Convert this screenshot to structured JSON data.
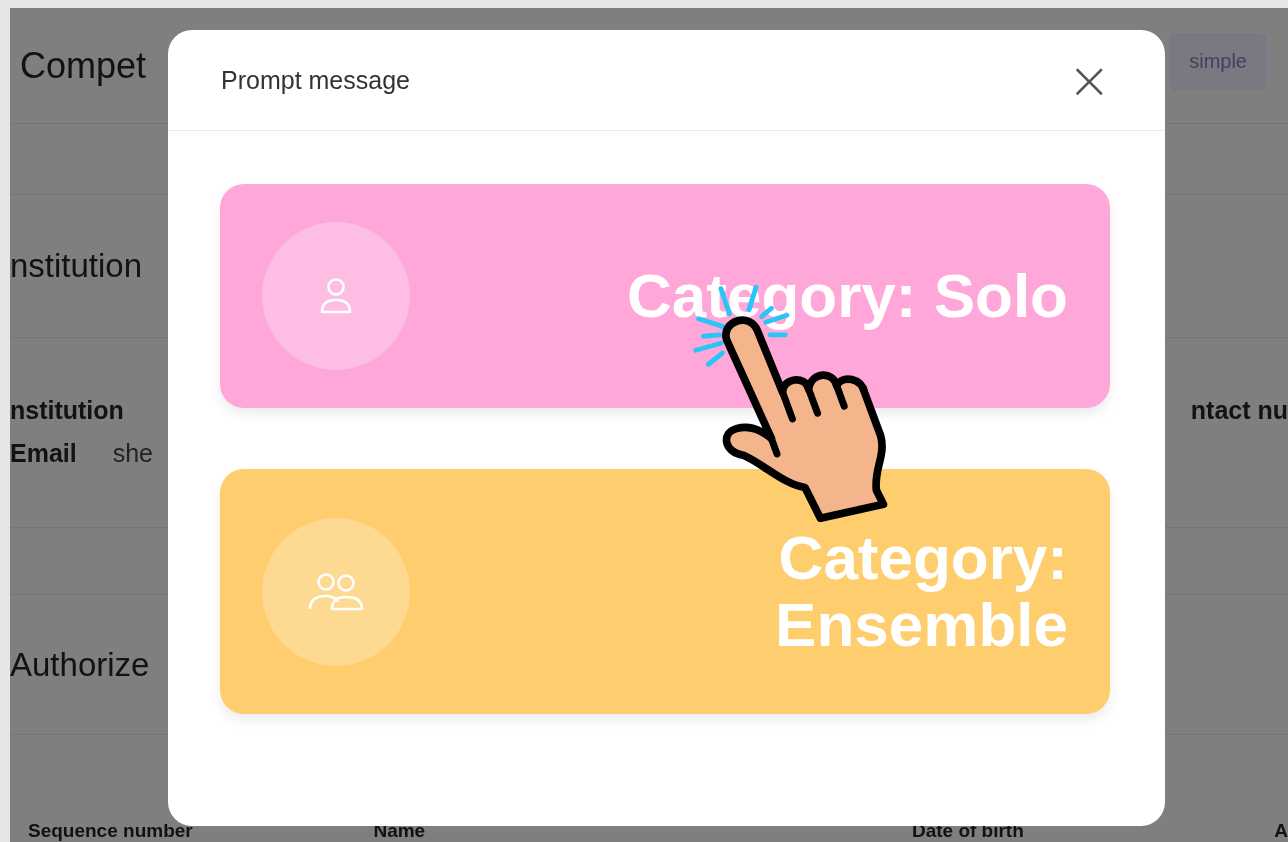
{
  "page": {
    "title": "Compet",
    "buttons": [
      "simple"
    ],
    "section_title": "nstitution",
    "info_left": [
      {
        "label": "nstitution"
      },
      {
        "label": "Email",
        "value": "she"
      }
    ],
    "info_right": "ntact nu",
    "authorized_title": "Authorize",
    "table": {
      "columns": [
        "Sequence number",
        "Name",
        "Date of birth",
        "A"
      ]
    }
  },
  "modal": {
    "title": "Prompt message",
    "close": "×",
    "options": [
      {
        "kind": "solo",
        "label": "Category: Solo",
        "color": "#fea7d8"
      },
      {
        "kind": "ensemble",
        "label": "Category: Ensemble",
        "color": "#fecd6e"
      }
    ]
  }
}
